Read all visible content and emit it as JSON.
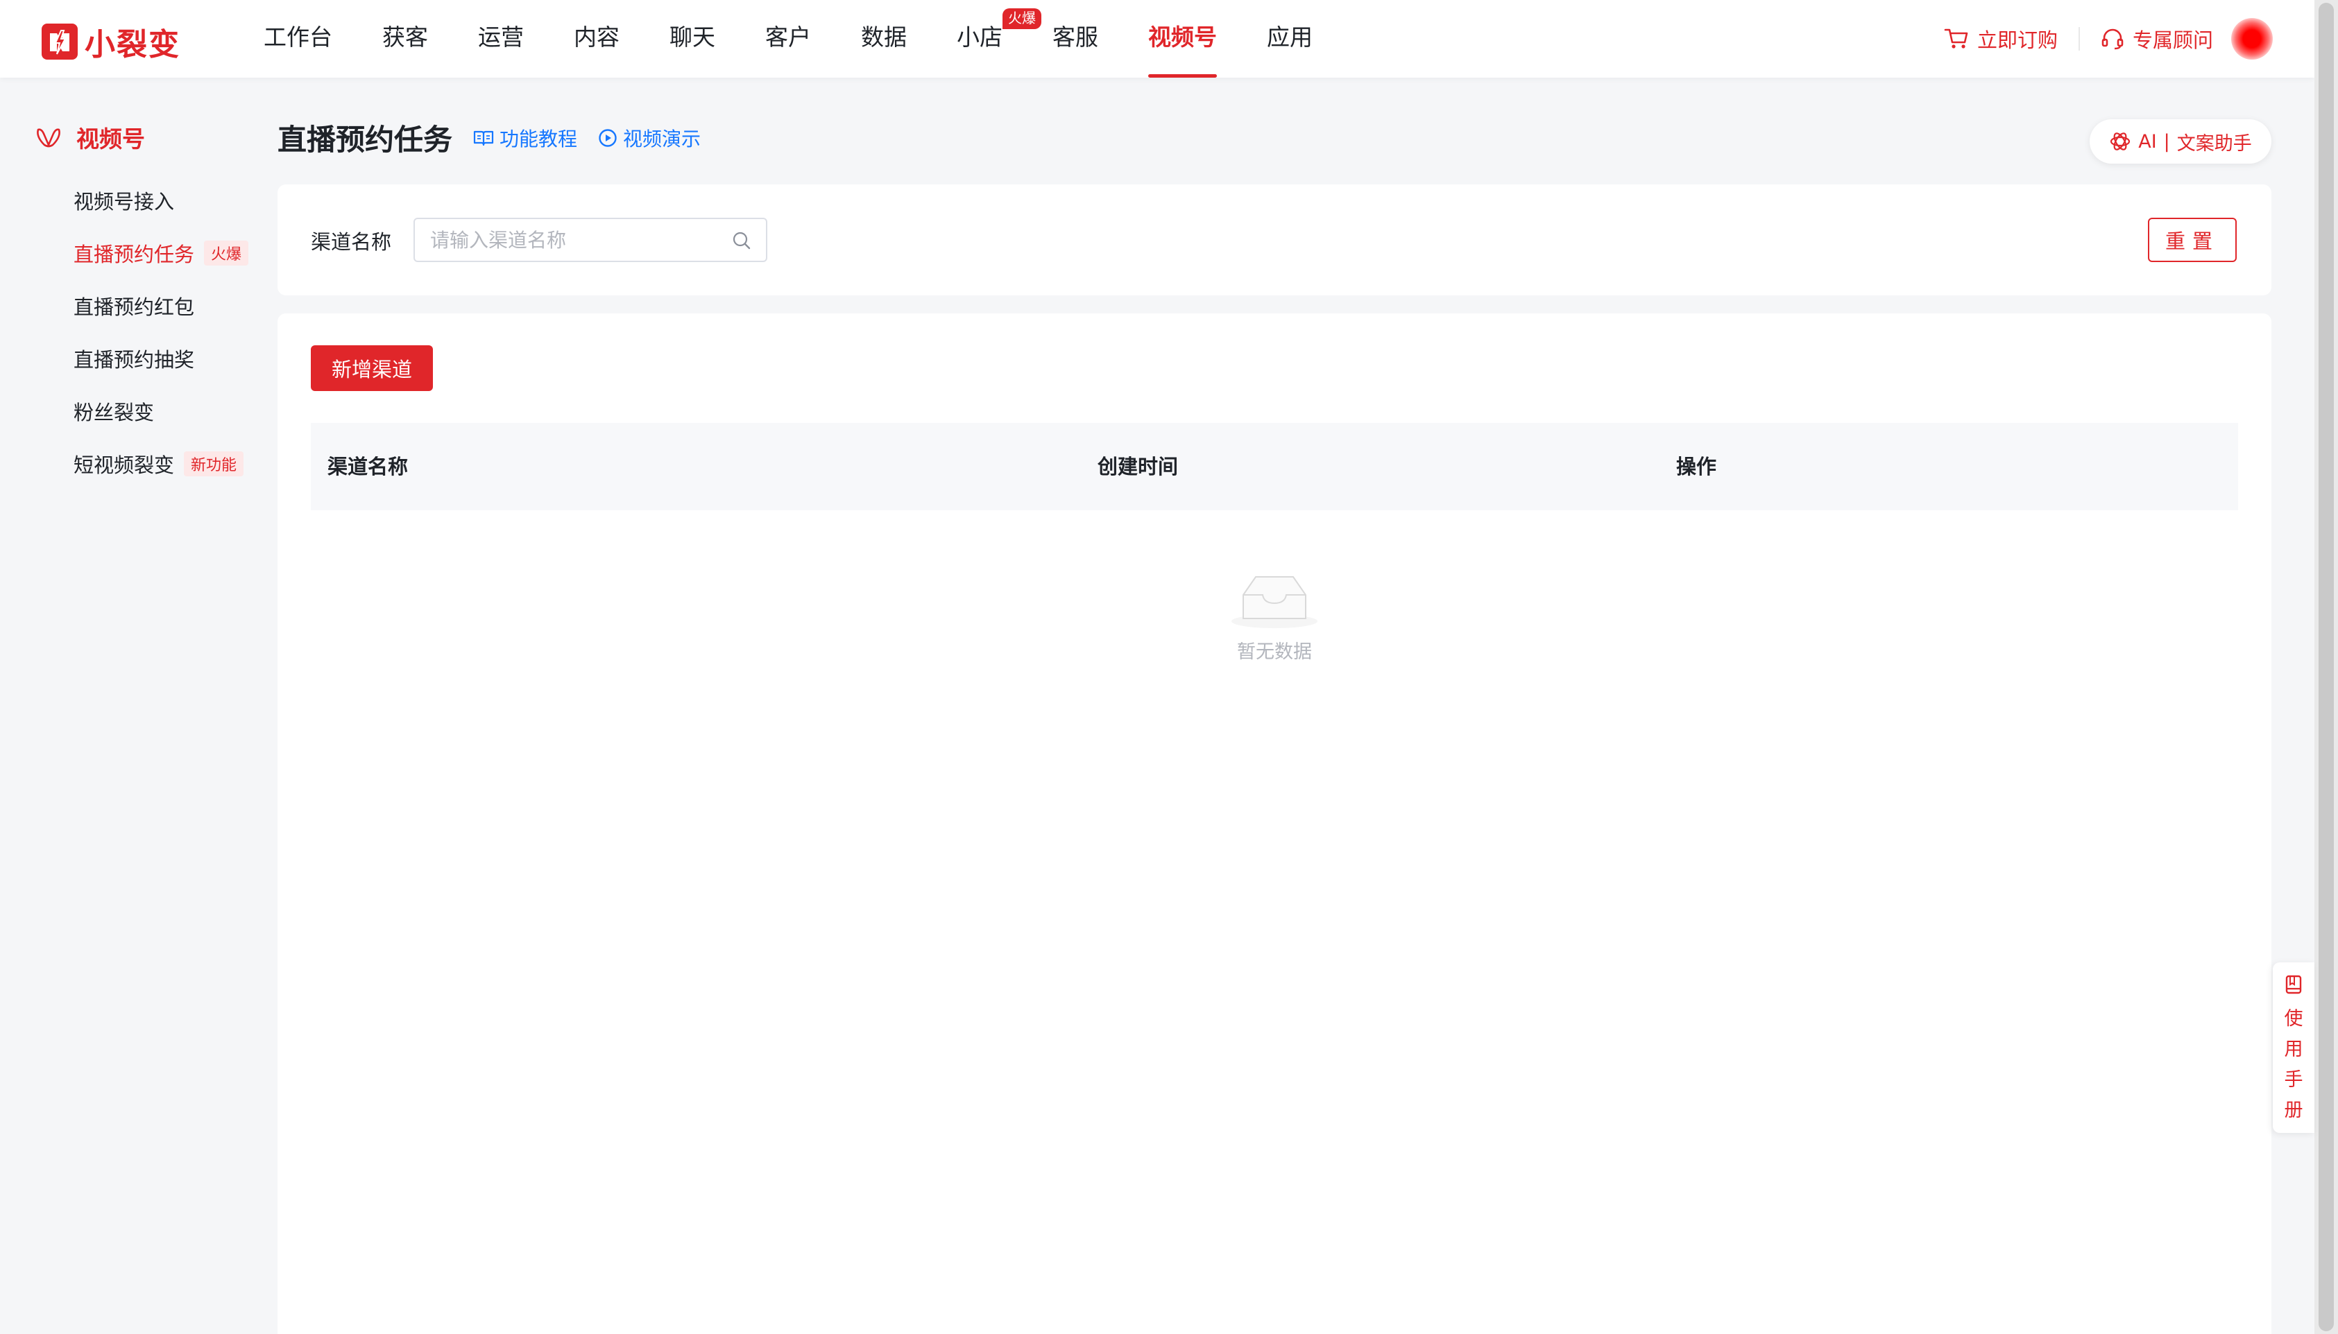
{
  "brand": {
    "name": "小裂变",
    "color": "#e0262a"
  },
  "nav": {
    "items": [
      {
        "label": "工作台"
      },
      {
        "label": "获客"
      },
      {
        "label": "运营"
      },
      {
        "label": "内容"
      },
      {
        "label": "聊天"
      },
      {
        "label": "客户"
      },
      {
        "label": "数据"
      },
      {
        "label": "小店",
        "badge": "火爆"
      },
      {
        "label": "客服"
      },
      {
        "label": "视频号",
        "active": true
      },
      {
        "label": "应用"
      }
    ]
  },
  "top_right": {
    "order_label": "立即订购",
    "consultant_label": "专属顾问"
  },
  "sidebar": {
    "header": "视频号",
    "items": [
      {
        "label": "视频号接入"
      },
      {
        "label": "直播预约任务",
        "tag": "火爆",
        "active": true
      },
      {
        "label": "直播预约红包"
      },
      {
        "label": "直播预约抽奖"
      },
      {
        "label": "粉丝裂变"
      },
      {
        "label": "短视频裂变",
        "tag": "新功能"
      }
    ]
  },
  "page": {
    "title": "直播预约任务",
    "tutorial_link": "功能教程",
    "video_link": "视频演示",
    "ai_button": {
      "prefix": "AI",
      "label": "文案助手"
    }
  },
  "filter": {
    "label": "渠道名称",
    "placeholder": "请输入渠道名称",
    "value": "",
    "reset_label": "重置"
  },
  "table": {
    "add_button": "新增渠道",
    "columns": [
      "渠道名称",
      "创建时间",
      "操作"
    ],
    "rows": [],
    "empty_text": "暂无数据"
  },
  "manual": {
    "label": "使用手册"
  }
}
